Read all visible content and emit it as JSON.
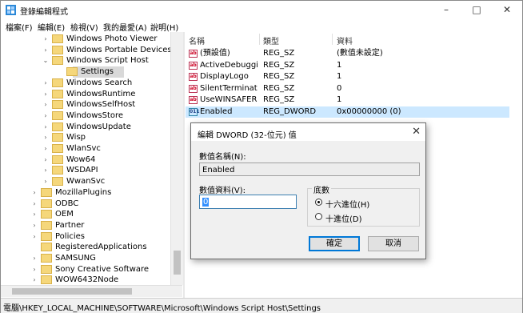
{
  "window": {
    "title": "登錄編輯程式",
    "controls": {
      "minimize": "–",
      "maximize": "□",
      "close": "✕"
    }
  },
  "menubar": [
    "檔案(F)",
    "編輯(E)",
    "檢視(V)",
    "我的最愛(A)",
    "說明(H)"
  ],
  "tree": {
    "rows": [
      {
        "label": "Windows Photo Viewer",
        "expander": "›"
      },
      {
        "label": "Windows Portable Devices",
        "expander": "›"
      },
      {
        "label": "Windows Script Host",
        "expander": "⌄"
      },
      {
        "label": "Settings",
        "expander": ""
      },
      {
        "label": "Windows Search",
        "expander": "›"
      },
      {
        "label": "WindowsRuntime",
        "expander": "›"
      },
      {
        "label": "WindowsSelfHost",
        "expander": "›"
      },
      {
        "label": "WindowsStore",
        "expander": "›"
      },
      {
        "label": "WindowsUpdate",
        "expander": "›"
      },
      {
        "label": "Wisp",
        "expander": "›"
      },
      {
        "label": "WlanSvc",
        "expander": "›"
      },
      {
        "label": "Wow64",
        "expander": "›"
      },
      {
        "label": "WSDAPI",
        "expander": "›"
      },
      {
        "label": "WwanSvc",
        "expander": "›"
      },
      {
        "label": "MozillaPlugins",
        "expander": "›"
      },
      {
        "label": "ODBC",
        "expander": "›"
      },
      {
        "label": "OEM",
        "expander": "›"
      },
      {
        "label": "Partner",
        "expander": "›"
      },
      {
        "label": "Policies",
        "expander": "›"
      },
      {
        "label": "RegisteredApplications",
        "expander": ""
      },
      {
        "label": "SAMSUNG",
        "expander": "›"
      },
      {
        "label": "Sony Creative Software",
        "expander": "›"
      },
      {
        "label": "WOW6432Node",
        "expander": "›"
      }
    ]
  },
  "list": {
    "headers": {
      "name": "名稱",
      "type": "類型",
      "data": "資料"
    },
    "rows": [
      {
        "icon": "ab",
        "name": "(預設值)",
        "type": "REG_SZ",
        "data": "(數值未設定)"
      },
      {
        "icon": "ab",
        "name": "ActiveDebuggi...",
        "type": "REG_SZ",
        "data": "1"
      },
      {
        "icon": "ab",
        "name": "DisplayLogo",
        "type": "REG_SZ",
        "data": "1"
      },
      {
        "icon": "ab",
        "name": "SilentTerminate",
        "type": "REG_SZ",
        "data": "0"
      },
      {
        "icon": "ab",
        "name": "UseWINSAFER",
        "type": "REG_SZ",
        "data": "1"
      },
      {
        "icon": "011",
        "name": "Enabled",
        "type": "REG_DWORD",
        "data": "0x00000000 (0)"
      }
    ]
  },
  "dialog": {
    "title": "編輯 DWORD (32-位元) 值",
    "close": "✕",
    "value_name_label": "數值名稱(N):",
    "value_name": "Enabled",
    "value_data_label": "數值資料(V):",
    "value_data": "0",
    "base_label": "底數",
    "hex_label": "十六進位(H)",
    "dec_label": "十進位(D)",
    "ok": "確定",
    "cancel": "取消"
  },
  "status": "電腦\\HKEY_LOCAL_MACHINE\\SOFTWARE\\Microsoft\\Windows Script Host\\Settings",
  "colors": {
    "selection": "#cce8ff",
    "folder": "#f5d77b",
    "accent": "#0078d7"
  }
}
